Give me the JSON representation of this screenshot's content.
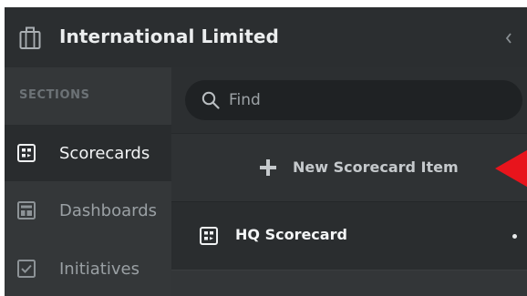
{
  "header": {
    "org_name": "International Limited",
    "org_icon": "briefcase-icon",
    "collapse_icon": "chevron-left-icon"
  },
  "sidebar": {
    "heading": "SECTIONS",
    "items": [
      {
        "label": "Scorecards",
        "icon": "scorecard-icon",
        "active": true
      },
      {
        "label": "Dashboards",
        "icon": "dashboard-icon",
        "active": false
      },
      {
        "label": "Initiatives",
        "icon": "checkbox-icon",
        "active": false
      }
    ]
  },
  "main": {
    "search": {
      "placeholder": "Find",
      "value": "",
      "icon": "search-icon"
    },
    "new_item": {
      "label": "New Scorecard Item",
      "icon": "plus-icon"
    },
    "list": [
      {
        "label": "HQ Scorecard",
        "icon": "scorecard-icon"
      }
    ]
  },
  "colors": {
    "accent_arrow": "#e8141c",
    "header_bg": "#2b2e30",
    "sidebar_bg": "#343739",
    "active_bg": "#292c2e"
  }
}
